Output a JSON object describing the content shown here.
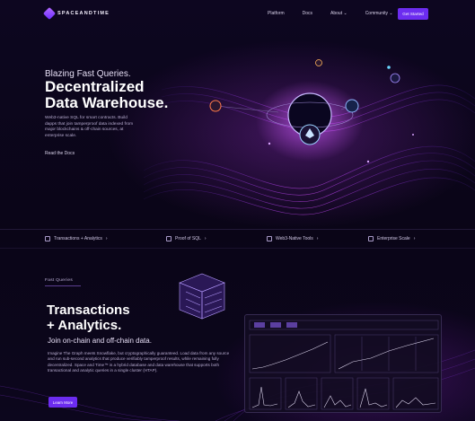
{
  "brand": {
    "name": "SPACEANDTIME",
    "accent": "#6c2cf0"
  },
  "nav": {
    "links": [
      "Platform",
      "Docs",
      "About ⌄",
      "Community ⌄"
    ],
    "cta_label": "Get Started"
  },
  "hero": {
    "eyebrow": "Blazing Fast Queries.",
    "title_line1": "Decentralized",
    "title_line2": "Data Warehouse.",
    "description": "Web3-native SQL for smart contracts. Build dapps that join tamperproof data indexed from major blockchains & off-chain sources, at enterprise scale.",
    "link": "Read the Docs",
    "nodes": [
      "Avalanche",
      "Ethereum",
      "Polygon",
      "Chainlink",
      "Bitcoin"
    ]
  },
  "features": [
    {
      "icon": "chart-icon",
      "label": "Transactions + Analytics"
    },
    {
      "icon": "proof-icon",
      "label": "Proof of SQL"
    },
    {
      "icon": "tools-icon",
      "label": "Web3-Native Tools"
    },
    {
      "icon": "scale-icon",
      "label": "Enterprise Scale"
    }
  ],
  "section": {
    "tag": "Fast Queries",
    "title_line1": "Transactions",
    "title_line2": "+ Analytics.",
    "subtitle": "Join on-chain and off-chain data.",
    "description": "Imagine The Graph meets Snowflake, but cryptographically guaranteed. Load data from any source and run sub-second analytics that produce verifiably tamperproof results, while remaining fully decentralized. Space and Time™ is a hybrid database and data warehouse that supports both transactional and analytic queries in a single cluster (HTAP).",
    "button_label": "Learn More"
  }
}
